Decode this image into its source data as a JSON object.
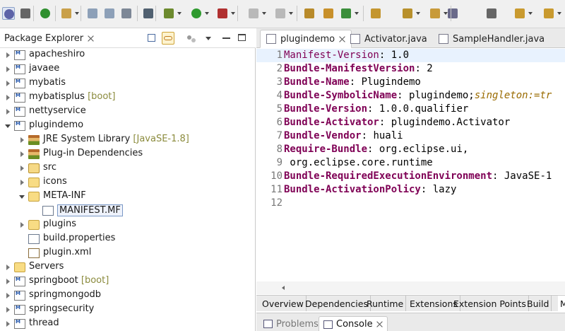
{
  "toolbar": {
    "icons": [
      "eclipse-orb-icon",
      "skip-breakpoints-icon",
      "terminate-icon",
      "new-wizard-icon",
      "save-icon",
      "save-all-icon",
      "print-icon",
      "binary-icon",
      "debug-icon",
      "run-icon",
      "run-external-icon",
      "stop-icon",
      "open-type-icon",
      "package-icon",
      "new-java-class-icon",
      "open-folder-icon",
      "edit-icon",
      "open-resource-icon",
      "toggle-mark-icon",
      "show-whitespace-icon",
      "next-annotation-icon",
      "prev-annotation-icon",
      "back-icon"
    ]
  },
  "explorer": {
    "title": "Package Explorer",
    "items": [
      {
        "label": "apacheshiro",
        "decoration": "",
        "depth": 0,
        "state": "collapsed",
        "icon": "project"
      },
      {
        "label": "javaee",
        "decoration": "",
        "depth": 0,
        "state": "collapsed",
        "icon": "project"
      },
      {
        "label": "mybatis",
        "decoration": "",
        "depth": 0,
        "state": "collapsed",
        "icon": "project"
      },
      {
        "label": "mybatisplus",
        "decoration": " [boot]",
        "depth": 0,
        "state": "collapsed",
        "icon": "project"
      },
      {
        "label": "nettyservice",
        "decoration": "",
        "depth": 0,
        "state": "collapsed",
        "icon": "project"
      },
      {
        "label": "plugindemo",
        "decoration": "",
        "depth": 0,
        "state": "expanded",
        "icon": "project"
      },
      {
        "label": "JRE System Library",
        "decoration": " [JavaSE-1.8]",
        "depth": 1,
        "state": "collapsed",
        "icon": "library"
      },
      {
        "label": "Plug-in Dependencies",
        "decoration": "",
        "depth": 1,
        "state": "collapsed",
        "icon": "library"
      },
      {
        "label": "src",
        "decoration": "",
        "depth": 1,
        "state": "collapsed",
        "icon": "source-folder"
      },
      {
        "label": "icons",
        "decoration": "",
        "depth": 1,
        "state": "collapsed",
        "icon": "folder"
      },
      {
        "label": "META-INF",
        "decoration": "",
        "depth": 1,
        "state": "expanded",
        "icon": "folder"
      },
      {
        "label": "MANIFEST.MF",
        "decoration": "",
        "depth": 2,
        "state": "none",
        "icon": "file",
        "selected": true
      },
      {
        "label": "plugins",
        "decoration": "",
        "depth": 1,
        "state": "collapsed",
        "icon": "folder"
      },
      {
        "label": "build.properties",
        "decoration": "",
        "depth": 1,
        "state": "none",
        "icon": "file"
      },
      {
        "label": "plugin.xml",
        "decoration": "",
        "depth": 1,
        "state": "none",
        "icon": "xml"
      },
      {
        "label": "Servers",
        "decoration": "",
        "depth": 0,
        "state": "collapsed",
        "icon": "folder"
      },
      {
        "label": "springboot",
        "decoration": " [boot]",
        "depth": 0,
        "state": "collapsed",
        "icon": "project"
      },
      {
        "label": "springmongodb",
        "decoration": "",
        "depth": 0,
        "state": "collapsed",
        "icon": "project"
      },
      {
        "label": "springsecurity",
        "decoration": "",
        "depth": 0,
        "state": "collapsed",
        "icon": "project"
      },
      {
        "label": "thread",
        "decoration": "",
        "depth": 0,
        "state": "collapsed",
        "icon": "project"
      }
    ]
  },
  "editor": {
    "tabs": [
      {
        "label": "plugindemo",
        "active": true,
        "closable": true
      },
      {
        "label": "Activator.java",
        "active": false,
        "closable": false
      },
      {
        "label": "SampleHandler.java",
        "active": false,
        "closable": false
      }
    ],
    "lines": [
      {
        "num": "1",
        "key": "Manifest-Version",
        "sep": ": ",
        "val": "1.0",
        "extra": "",
        "current": true
      },
      {
        "num": "2",
        "key": "Bundle-ManifestVersion",
        "sep": ": ",
        "val": "2",
        "extra": ""
      },
      {
        "num": "3",
        "key": "Bundle-Name",
        "sep": ": ",
        "val": "Plugindemo",
        "extra": ""
      },
      {
        "num": "4",
        "key": "Bundle-SymbolicName",
        "sep": ": ",
        "val": "plugindemo;",
        "extra": "singleton:=tr"
      },
      {
        "num": "5",
        "key": "Bundle-Version",
        "sep": ": ",
        "val": "1.0.0.qualifier",
        "extra": ""
      },
      {
        "num": "6",
        "key": "Bundle-Activator",
        "sep": ": ",
        "val": "plugindemo.Activator",
        "extra": ""
      },
      {
        "num": "7",
        "key": "Bundle-Vendor",
        "sep": ": ",
        "val": "huali",
        "extra": ""
      },
      {
        "num": "8",
        "key": "Require-Bundle",
        "sep": ": ",
        "val": "org.eclipse.ui,",
        "extra": ""
      },
      {
        "num": "9",
        "key": "",
        "sep": "",
        "val": " org.eclipse.core.runtime",
        "extra": ""
      },
      {
        "num": "10",
        "key": "Bundle-RequiredExecutionEnvironment",
        "sep": ": ",
        "val": "JavaSE-1",
        "extra": ""
      },
      {
        "num": "11",
        "key": "Bundle-ActivationPolicy",
        "sep": ": ",
        "val": "lazy",
        "extra": ""
      },
      {
        "num": "12",
        "key": "",
        "sep": "",
        "val": "",
        "extra": ""
      }
    ],
    "page_tabs": [
      "Overview",
      "Dependencies",
      "Runtime",
      "Extensions",
      "Extension Points",
      "Build",
      "M"
    ]
  },
  "bottom": {
    "tabs": [
      {
        "label": "Problems",
        "active": false
      },
      {
        "label": "Console",
        "active": true
      }
    ]
  },
  "colors": {
    "keyword": "#7f0055",
    "attribute": "#9a6b00",
    "decoration": "#8b8b3d"
  }
}
